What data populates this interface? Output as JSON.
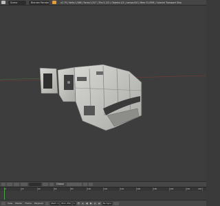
{
  "topbar": {
    "scene_field": "Scene",
    "render_engine": "Blender Render",
    "stats": "v2.79 | Verts:1,566 | Faces:1,517 | Tris:3,122 | Objects:1/2 | Lamps:0/0 | Mem:31.65M | Colonial Transport Ship"
  },
  "toolbar": {
    "mode_label": "Global"
  },
  "timeline": {
    "tick_labels": [
      "0",
      "20",
      "40",
      "60",
      "80",
      "100",
      "120",
      "140",
      "160",
      "180",
      "200",
      "220",
      "240"
    ]
  },
  "bottombar": {
    "view_label": "View",
    "marker_label": "Marker",
    "frame_label": "Frame",
    "playback_label": "Playback",
    "start_label": "Start: 1",
    "end_label": "End: 250",
    "current_frame": "1",
    "sync_label": "No Sync"
  },
  "colors": {
    "background": "#3d3d3d",
    "hull": "#c9c9c6",
    "panel_dark": "#4a4a4a",
    "axis_red": "#b24a4a",
    "axis_green": "#6fa84b",
    "playhead": "#4fa14a"
  }
}
